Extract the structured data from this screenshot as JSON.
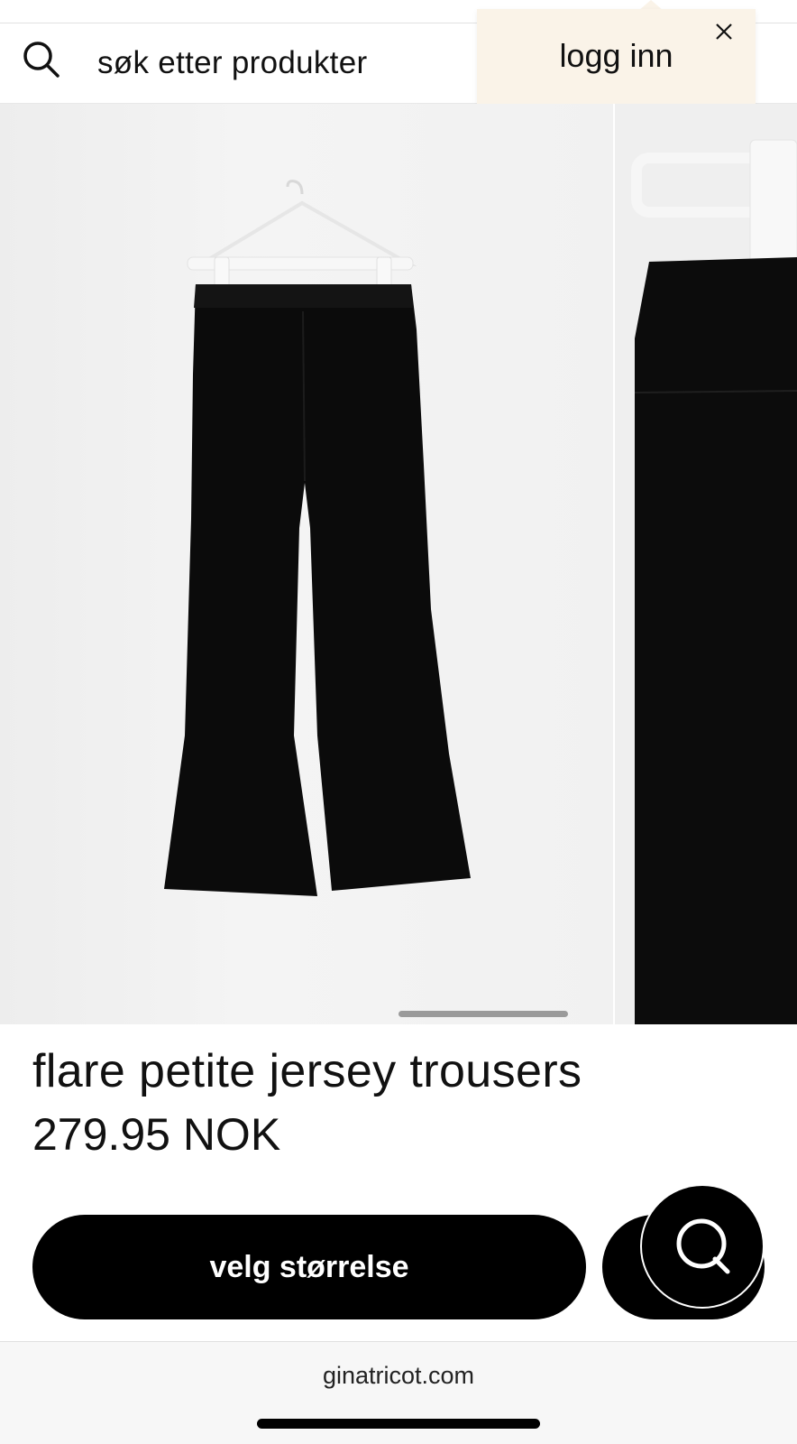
{
  "header": {
    "search_placeholder": "søk etter produkter",
    "search_icon": "search-icon"
  },
  "login_popover": {
    "label": "logg inn",
    "close_icon": "close-icon"
  },
  "gallery": {
    "images": [
      {
        "alt": "black flare jersey trousers on hanger"
      },
      {
        "alt": "waistband close-up"
      }
    ],
    "active_index": 0
  },
  "product": {
    "title": "flare petite jersey trousers",
    "price": "279.95 NOK"
  },
  "actions": {
    "size_button_label": "velg størrelse",
    "chat_icon": "chat-icon"
  },
  "browser": {
    "domain": "ginatricot.com"
  },
  "colors": {
    "popover_bg": "#faf3e8",
    "button_bg": "#000000",
    "text": "#111111"
  }
}
